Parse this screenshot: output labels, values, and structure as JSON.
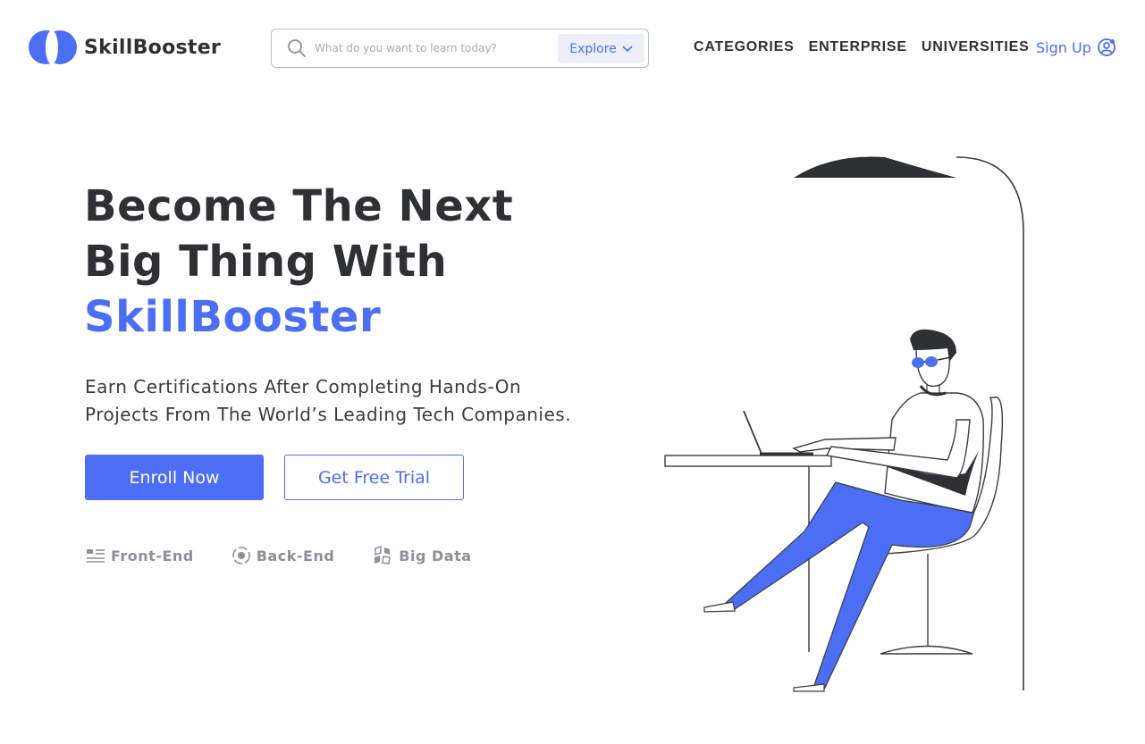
{
  "brand": {
    "name": "SkillBooster",
    "accent_color": "#4c6ef5",
    "text_color": "#2f3033"
  },
  "search": {
    "placeholder": "What do you want to learn today?",
    "explore_label": "Explore",
    "icon": "search-icon"
  },
  "nav": {
    "items": [
      {
        "label": "CATEGORIES"
      },
      {
        "label": "ENTERPRISE"
      },
      {
        "label": "UNIVERSITIES"
      }
    ]
  },
  "signup": {
    "label": "Sign Up",
    "icon": "user-circle-icon"
  },
  "hero": {
    "title_line1": "Become The Next",
    "title_line2": "Big Thing With",
    "title_accent": "SkillBooster",
    "subtitle_line1": "Earn Certifications After Completing Hands-On",
    "subtitle_line2": "Projects From The World’s Leading Tech Companies.",
    "primary_button": "Enroll Now",
    "secondary_button": "Get Free Trial"
  },
  "topics": [
    {
      "label": "Front-End",
      "icon": "list-icon"
    },
    {
      "label": "Back-End",
      "icon": "target-icon"
    },
    {
      "label": "Big Data",
      "icon": "data-cubes-icon"
    }
  ]
}
